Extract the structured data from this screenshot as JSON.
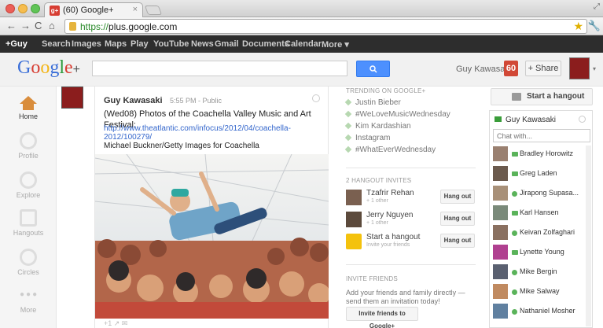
{
  "browser": {
    "tab_title": "(60) Google+",
    "favicon_text": "g+",
    "url_scheme": "https://",
    "url_host": "plus.google.com"
  },
  "gbar": {
    "items": [
      "+Guy",
      "Search",
      "Images",
      "Maps",
      "Play",
      "YouTube",
      "News",
      "Gmail",
      "Documents",
      "Calendar",
      "More ▾"
    ]
  },
  "header": {
    "search_placeholder": "",
    "search_icon": "search-icon",
    "user_name": "Guy Kawasaki",
    "notification_count": "60",
    "share_label": "+ Share"
  },
  "rail": {
    "items": [
      "Home",
      "Profile",
      "Explore",
      "Hangouts",
      "Circles",
      "More"
    ]
  },
  "post": {
    "author": "Guy Kawasaki",
    "time": "5:55 PM  -  Public",
    "text": "(Wed08) Photos of the Coachella Valley Music and Art Festival:",
    "link": "http://www.theatlantic.com/infocus/2012/04/coachella-2012/100279/",
    "credit": "Michael Buckner/Getty Images for Coachella",
    "actions": "+1     ↗     ✉"
  },
  "trending": {
    "heading": "TRENDING ON GOOGLE+",
    "items": [
      "Justin Bieber",
      "#WeLoveMusicWednesday",
      "Kim Kardashian",
      "Instagram",
      "#WhatEverWednesday"
    ]
  },
  "hangout_invites": {
    "heading": "2 HANGOUT INVITES",
    "rows": [
      {
        "name": "Tzafrir Rehan",
        "sub": "+ 1 other",
        "button": "Hang out"
      },
      {
        "name": "Jerry Nguyen",
        "sub": "+ 1 other",
        "button": "Hang out"
      },
      {
        "name": "Start a hangout",
        "sub": "Invite your friends",
        "button": "Hang out"
      }
    ]
  },
  "invite_friends": {
    "heading": "INVITE FRIENDS",
    "text": "Add your friends and family directly — send them an invitation today!",
    "button": "Invite friends to Google+"
  },
  "hangout_panel": {
    "start_label": "Start a hangout",
    "me": "Guy Kawasaki",
    "chat_placeholder": "Chat with...",
    "contacts": [
      {
        "name": "Bradley Horowitz",
        "status": "video"
      },
      {
        "name": "Greg Laden",
        "status": "video"
      },
      {
        "name": "Jirapong Supasa...",
        "status": "online"
      },
      {
        "name": "Karl Hansen",
        "status": "video"
      },
      {
        "name": "Keivan Zolfaghari",
        "status": "online"
      },
      {
        "name": "Lynette Young",
        "status": "video"
      },
      {
        "name": "Mike Bergin",
        "status": "online"
      },
      {
        "name": "Mike Salway",
        "status": "online"
      },
      {
        "name": "Nathaniel Mosher",
        "status": "online"
      }
    ]
  },
  "colors": {
    "accent_blue": "#4d90fe",
    "notification_red": "#d14836",
    "online_green": "#5ab35a",
    "gbar_black": "#2d2d2d"
  }
}
